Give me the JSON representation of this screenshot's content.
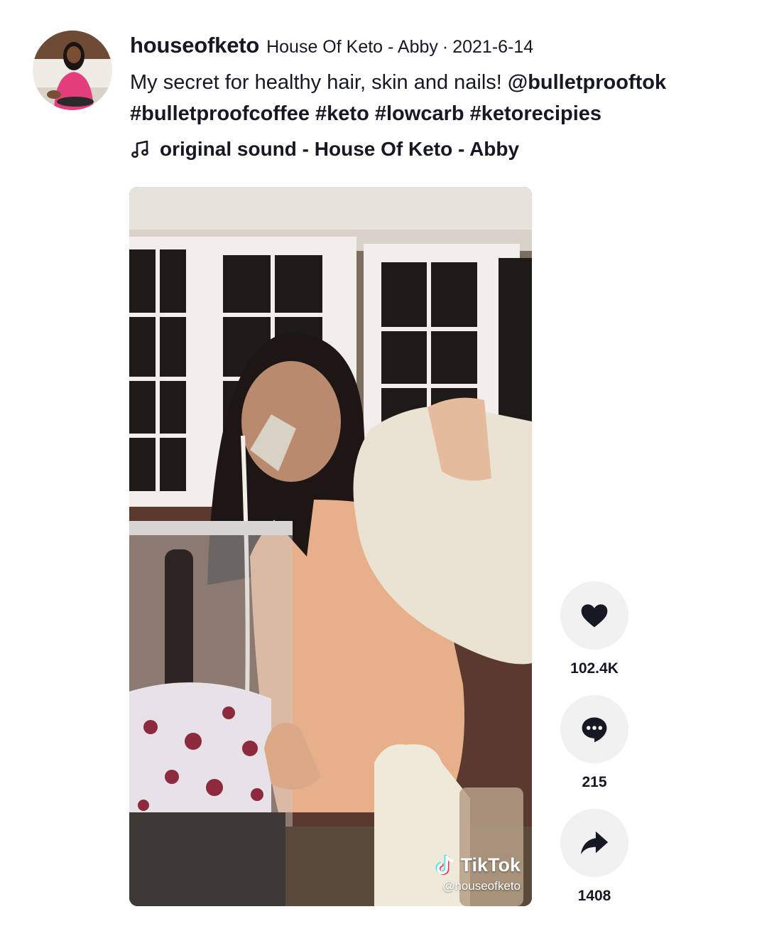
{
  "post": {
    "username": "houseofketo",
    "nickname": "House Of Keto - Abby",
    "separator": "·",
    "date": "2021-6-14",
    "caption_text": "My secret for healthy hair, skin and nails! ",
    "mention": "@bulletprooftok",
    "hashtags": [
      "#bulletproofcoffee",
      "#keto",
      "#lowcarb",
      "#ketorecipies"
    ],
    "music": "original sound - House Of Keto - Abby"
  },
  "video": {
    "watermark_brand": "TikTok",
    "watermark_handle": "@houseofketo"
  },
  "actions": {
    "likes": "102.4K",
    "comments": "215",
    "shares": "1408"
  },
  "icons": [
    "music-note-icon",
    "heart-icon",
    "comment-icon",
    "share-icon",
    "tiktok-logo-icon"
  ]
}
